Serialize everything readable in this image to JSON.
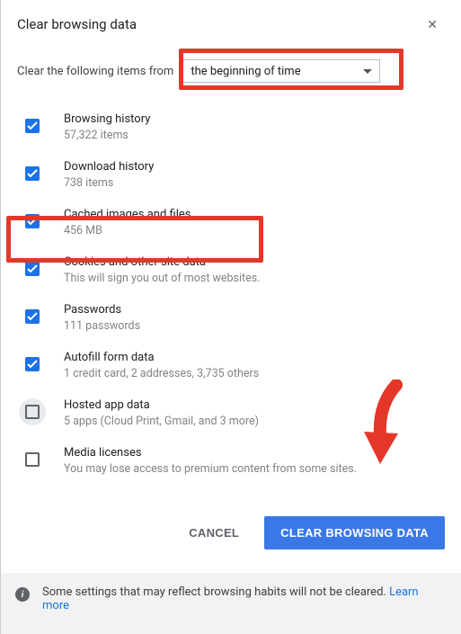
{
  "title": "Clear browsing data",
  "time_label": "Clear the following items from",
  "time_value": "the beginning of time",
  "items": [
    {
      "title": "Browsing history",
      "sub": "57,322 items",
      "checked": true,
      "focus": false
    },
    {
      "title": "Download history",
      "sub": "738 items",
      "checked": true,
      "focus": false
    },
    {
      "title": "Cached images and files",
      "sub": "456 MB",
      "checked": true,
      "focus": false
    },
    {
      "title": "Cookies and other site data",
      "sub": "This will sign you out of most websites.",
      "checked": true,
      "focus": false
    },
    {
      "title": "Passwords",
      "sub": "111 passwords",
      "checked": true,
      "focus": false
    },
    {
      "title": "Autofill form data",
      "sub": "1 credit card, 2 addresses, 3,735 others",
      "checked": true,
      "focus": false
    },
    {
      "title": "Hosted app data",
      "sub": "5 apps (Cloud Print, Gmail, and 3 more)",
      "checked": false,
      "focus": true
    },
    {
      "title": "Media licenses",
      "sub": "You may lose access to premium content from some sites.",
      "checked": false,
      "focus": false
    }
  ],
  "cancel_label": "CANCEL",
  "clear_label": "CLEAR BROWSING DATA",
  "footer_text": "Some settings that may reflect browsing habits will not be cleared.  ",
  "footer_link": "Learn more",
  "colors": {
    "accent": "#1a73e8",
    "primary_btn": "#3b78e7",
    "annotation": "#e53729"
  }
}
